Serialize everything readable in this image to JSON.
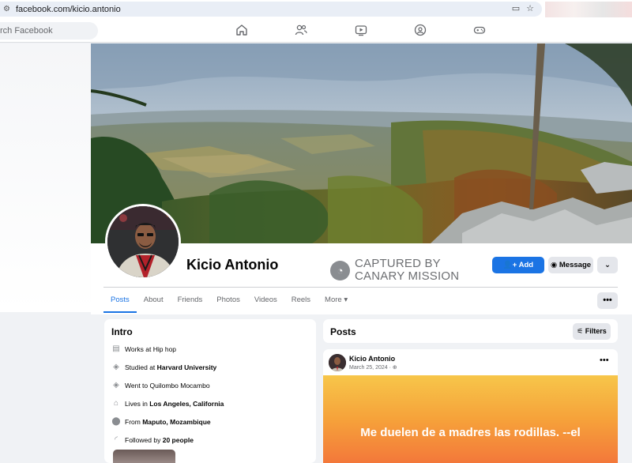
{
  "browser": {
    "url": "facebook.com/kicio.antonio"
  },
  "nav": {
    "search_placeholder": "Search Facebook",
    "search_visible": "rch Facebook",
    "icons": [
      "home-icon",
      "friends-icon",
      "video-icon",
      "groups-icon",
      "gaming-icon"
    ]
  },
  "profile": {
    "name": "Kicio Antonio",
    "overlay_text": "CAPTURED BY\nCANARY MISSION",
    "overlay_line1": "CAPTURED BY",
    "overlay_line2": "CANARY MISSION",
    "buttons": {
      "add_friend": "Add friend",
      "message": "Message"
    }
  },
  "tabs": [
    "Posts",
    "About",
    "Friends",
    "Photos",
    "Videos",
    "Reels",
    "More"
  ],
  "intro": {
    "title": "Intro",
    "items": [
      {
        "icon": "briefcase-icon",
        "prefix": "Works at Hip hop",
        "bold": ""
      },
      {
        "icon": "graduation-cap-icon",
        "prefix": "Studied at ",
        "bold": "Harvard University"
      },
      {
        "icon": "graduation-cap-icon",
        "prefix": "Went to Quilombo Mocambo",
        "bold": ""
      },
      {
        "icon": "home-icon",
        "prefix": "Lives in ",
        "bold": "Los Angeles, California"
      },
      {
        "icon": "location-pin-icon",
        "prefix": "From ",
        "bold": "Maputo, Mozambique"
      },
      {
        "icon": "rss-icon",
        "prefix": "Followed by ",
        "bold": "20 people"
      }
    ]
  },
  "posts": {
    "title": "Posts",
    "filters_label": "Filters",
    "post": {
      "author": "Kicio Antonio",
      "date": "March 25, 2024 ·",
      "text": "Me duelen de a madres las rodillas. --el"
    }
  },
  "colors": {
    "brand_blue": "#1b74e4",
    "bg": "#f0f2f5"
  }
}
